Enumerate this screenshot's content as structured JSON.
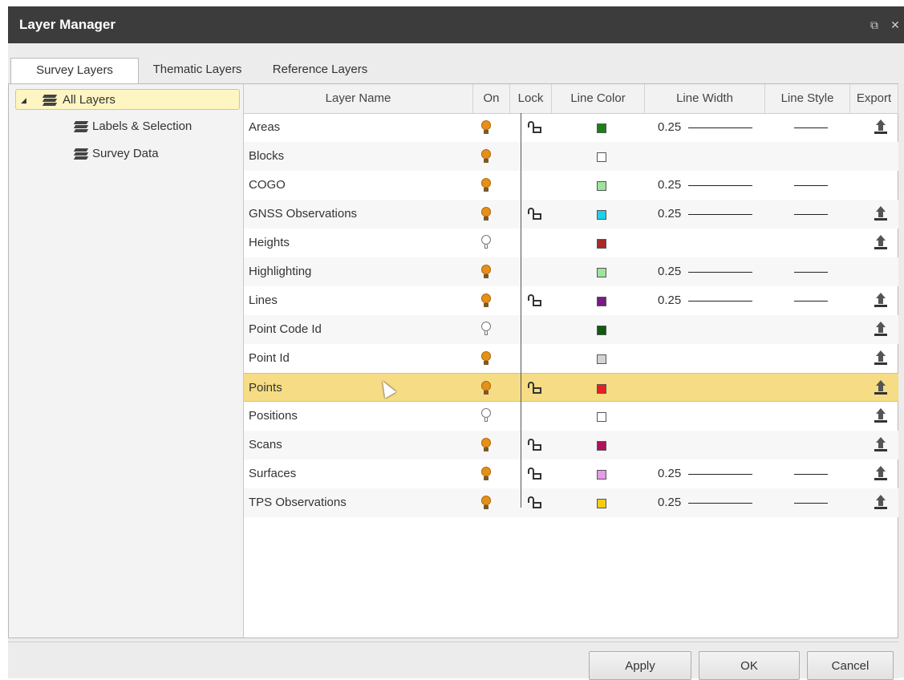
{
  "window": {
    "title": "Layer Manager",
    "restore_icon": "restore-icon",
    "close_icon": "close-icon"
  },
  "tabs": [
    {
      "label": "Survey Layers",
      "active": true
    },
    {
      "label": "Thematic Layers",
      "active": false
    },
    {
      "label": "Reference Layers",
      "active": false
    }
  ],
  "tree": [
    {
      "label": "All Layers",
      "selected": true,
      "expanded": true
    },
    {
      "label": "Labels & Selection"
    },
    {
      "label": "Survey Data"
    }
  ],
  "columns": [
    "Layer Name",
    "On",
    "Lock",
    "Line Color",
    "Line Width",
    "Line Style",
    "Export"
  ],
  "rows": [
    {
      "name": "Areas",
      "on": true,
      "lock": true,
      "color": "#1b7f1b",
      "width": "0.25",
      "style": true,
      "export": true
    },
    {
      "name": "Blocks",
      "on": true,
      "lock": false,
      "color": "#ffffff",
      "width": "",
      "style": false,
      "export": false
    },
    {
      "name": "COGO",
      "on": true,
      "lock": false,
      "color": "#9ee39e",
      "width": "0.25",
      "style": true,
      "export": false
    },
    {
      "name": "GNSS Observations",
      "on": true,
      "lock": true,
      "color": "#1fd0e8",
      "width": "0.25",
      "style": true,
      "export": true
    },
    {
      "name": "Heights",
      "on": false,
      "lock": false,
      "color": "#a52a2a",
      "width": "",
      "style": false,
      "export": true
    },
    {
      "name": "Highlighting",
      "on": true,
      "lock": false,
      "color": "#9ee39e",
      "width": "0.25",
      "style": true,
      "export": false
    },
    {
      "name": "Lines",
      "on": true,
      "lock": true,
      "color": "#7a1a86",
      "width": "0.25",
      "style": true,
      "export": true
    },
    {
      "name": "Point Code Id",
      "on": false,
      "lock": false,
      "color": "#0e5c0e",
      "width": "",
      "style": false,
      "export": true
    },
    {
      "name": "Point Id",
      "on": true,
      "lock": false,
      "color": "#d3d3d3",
      "width": "",
      "style": false,
      "export": true
    },
    {
      "name": "Points",
      "on": true,
      "lock": true,
      "color": "#e82020",
      "width": "",
      "style": false,
      "export": true,
      "selected": true
    },
    {
      "name": "Positions",
      "on": false,
      "lock": false,
      "color": "#ffffff",
      "width": "",
      "style": false,
      "export": true
    },
    {
      "name": "Scans",
      "on": true,
      "lock": true,
      "color": "#b0125a",
      "width": "",
      "style": false,
      "export": true
    },
    {
      "name": "Surfaces",
      "on": true,
      "lock": true,
      "color": "#e79ae7",
      "width": "0.25",
      "style": true,
      "export": true
    },
    {
      "name": "TPS Observations",
      "on": true,
      "lock": true,
      "color": "#f5cc14",
      "width": "0.25",
      "style": true,
      "export": true
    }
  ],
  "buttons": {
    "apply": "Apply",
    "ok": "OK",
    "cancel": "Cancel"
  }
}
